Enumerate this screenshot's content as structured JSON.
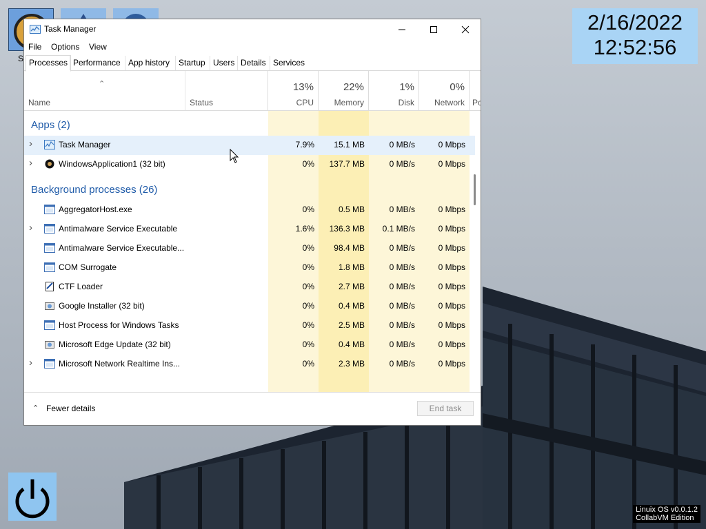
{
  "clock": {
    "date": "2/16/2022",
    "time": "12:52:56"
  },
  "version": {
    "line1": "Linuix OS v0.0.1.2",
    "line2": "CollabVM Edition"
  },
  "desktop_icon_label": "S",
  "window": {
    "title": "Task Manager",
    "controls": [
      "minimize-icon",
      "maximize-icon",
      "close-icon"
    ],
    "menu": [
      "File",
      "Options",
      "View"
    ],
    "tabs": [
      "Processes",
      "Performance",
      "App history",
      "Startup",
      "Users",
      "Details",
      "Services"
    ],
    "active_tab": "Processes"
  },
  "columns": {
    "name": "Name",
    "status": "Status",
    "cpu": {
      "pct": "13%",
      "label": "CPU"
    },
    "memory": {
      "pct": "22%",
      "label": "Memory"
    },
    "disk": {
      "pct": "1%",
      "label": "Disk"
    },
    "network": {
      "pct": "0%",
      "label": "Network"
    },
    "power": "Po"
  },
  "groups": {
    "apps": "Apps (2)",
    "background": "Background processes (26)"
  },
  "apps": [
    {
      "name": "Task Manager",
      "cpu": "7.9%",
      "memory": "15.1 MB",
      "disk": "0 MB/s",
      "network": "0 Mbps",
      "expand": true,
      "icon": "task-manager-icon"
    },
    {
      "name": "WindowsApplication1 (32 bit)",
      "cpu": "0%",
      "memory": "137.7 MB",
      "disk": "0 MB/s",
      "network": "0 Mbps",
      "expand": true,
      "icon": "app-icon"
    }
  ],
  "background": [
    {
      "name": "AggregatorHost.exe",
      "cpu": "0%",
      "memory": "0.5 MB",
      "disk": "0 MB/s",
      "network": "0 Mbps",
      "expand": false,
      "icon": "window-icon"
    },
    {
      "name": "Antimalware Service Executable",
      "cpu": "1.6%",
      "memory": "136.3 MB",
      "disk": "0.1 MB/s",
      "network": "0 Mbps",
      "expand": true,
      "icon": "window-icon"
    },
    {
      "name": "Antimalware Service Executable...",
      "cpu": "0%",
      "memory": "98.4 MB",
      "disk": "0 MB/s",
      "network": "0 Mbps",
      "expand": false,
      "icon": "window-icon"
    },
    {
      "name": "COM Surrogate",
      "cpu": "0%",
      "memory": "1.8 MB",
      "disk": "0 MB/s",
      "network": "0 Mbps",
      "expand": false,
      "icon": "window-icon"
    },
    {
      "name": "CTF Loader",
      "cpu": "0%",
      "memory": "2.7 MB",
      "disk": "0 MB/s",
      "network": "0 Mbps",
      "expand": false,
      "icon": "notepad-icon"
    },
    {
      "name": "Google Installer (32 bit)",
      "cpu": "0%",
      "memory": "0.4 MB",
      "disk": "0 MB/s",
      "network": "0 Mbps",
      "expand": false,
      "icon": "installer-icon"
    },
    {
      "name": "Host Process for Windows Tasks",
      "cpu": "0%",
      "memory": "2.5 MB",
      "disk": "0 MB/s",
      "network": "0 Mbps",
      "expand": false,
      "icon": "window-icon"
    },
    {
      "name": "Microsoft Edge Update (32 bit)",
      "cpu": "0%",
      "memory": "0.4 MB",
      "disk": "0 MB/s",
      "network": "0 Mbps",
      "expand": false,
      "icon": "installer-icon"
    },
    {
      "name": "Microsoft Network Realtime Ins...",
      "cpu": "0%",
      "memory": "2.3 MB",
      "disk": "0 MB/s",
      "network": "0 Mbps",
      "expand": true,
      "icon": "window-icon"
    }
  ],
  "footer": {
    "fewer_details": "Fewer details",
    "end_task": "End task"
  },
  "colors": {
    "heat_light": "#fff9db",
    "heat_mid": "#fff4c4",
    "heat_strong": "#ffeeab",
    "group_text": "#1e5aa8",
    "clock_bg": "#a9d4f5"
  }
}
